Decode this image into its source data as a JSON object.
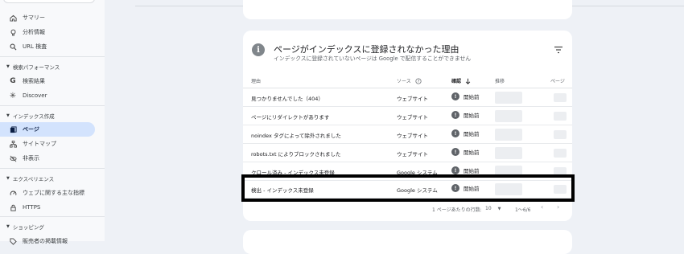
{
  "sidebar": {
    "top_items": [
      {
        "icon": "home-icon",
        "label": "サマリー"
      },
      {
        "icon": "lightbulb-icon",
        "label": "分析情報"
      },
      {
        "icon": "search-icon",
        "label": "URL 検査"
      }
    ],
    "sections": [
      {
        "title": "検索パフォーマンス",
        "items": [
          {
            "icon": "google-g-icon",
            "label": "検索結果"
          },
          {
            "icon": "asterisk-icon",
            "label": "Discover"
          }
        ]
      },
      {
        "title": "インデックス作成",
        "items": [
          {
            "icon": "pages-icon",
            "label": "ページ",
            "active": true
          },
          {
            "icon": "sitemap-icon",
            "label": "サイトマップ"
          },
          {
            "icon": "eye-off-icon",
            "label": "非表示"
          }
        ]
      },
      {
        "title": "エクスペリエンス",
        "items": [
          {
            "icon": "gauge-icon",
            "label": "ウェブに関する主な指標"
          },
          {
            "icon": "lock-icon",
            "label": "HTTPS"
          }
        ]
      },
      {
        "title": "ショッピング",
        "items": [
          {
            "icon": "tag-icon",
            "label": "販売者の掲載情報"
          }
        ]
      }
    ]
  },
  "card": {
    "title": "ページがインデックスに登録されなかった理由",
    "subtitle": "インデックスに登録されていないページは Google で配信することができません",
    "filter_icon": "filter-icon",
    "columns": {
      "reason": "理由",
      "source": "ソース",
      "status": "確認",
      "trend": "推移",
      "pages": "ページ"
    },
    "rows": [
      {
        "reason": "見つかりませんでした（404）",
        "source": "ウェブサイト",
        "status": "開始前"
      },
      {
        "reason": "ページにリダイレクトがあります",
        "source": "ウェブサイト",
        "status": "開始前"
      },
      {
        "reason": "noindex タグによって除外されました",
        "source": "ウェブサイト",
        "status": "開始前"
      },
      {
        "reason": "robots.txt によりブロックされました",
        "source": "ウェブサイト",
        "status": "開始前"
      },
      {
        "reason": "クロール済み - インデックス未登録",
        "source": "Google システム",
        "status": "開始前"
      },
      {
        "reason": "検出 - インデックス未登録",
        "source": "Google システム",
        "status": "開始前"
      }
    ],
    "pagination": {
      "rows_per_page_label": "1 ページあたりの行数:",
      "rows_per_page_value": "10",
      "range": "1〜6/6"
    }
  },
  "colors": {
    "active_nav_bg": "#d3e3fd",
    "status_dot": "#5f6368",
    "highlight_border": "#000000"
  }
}
